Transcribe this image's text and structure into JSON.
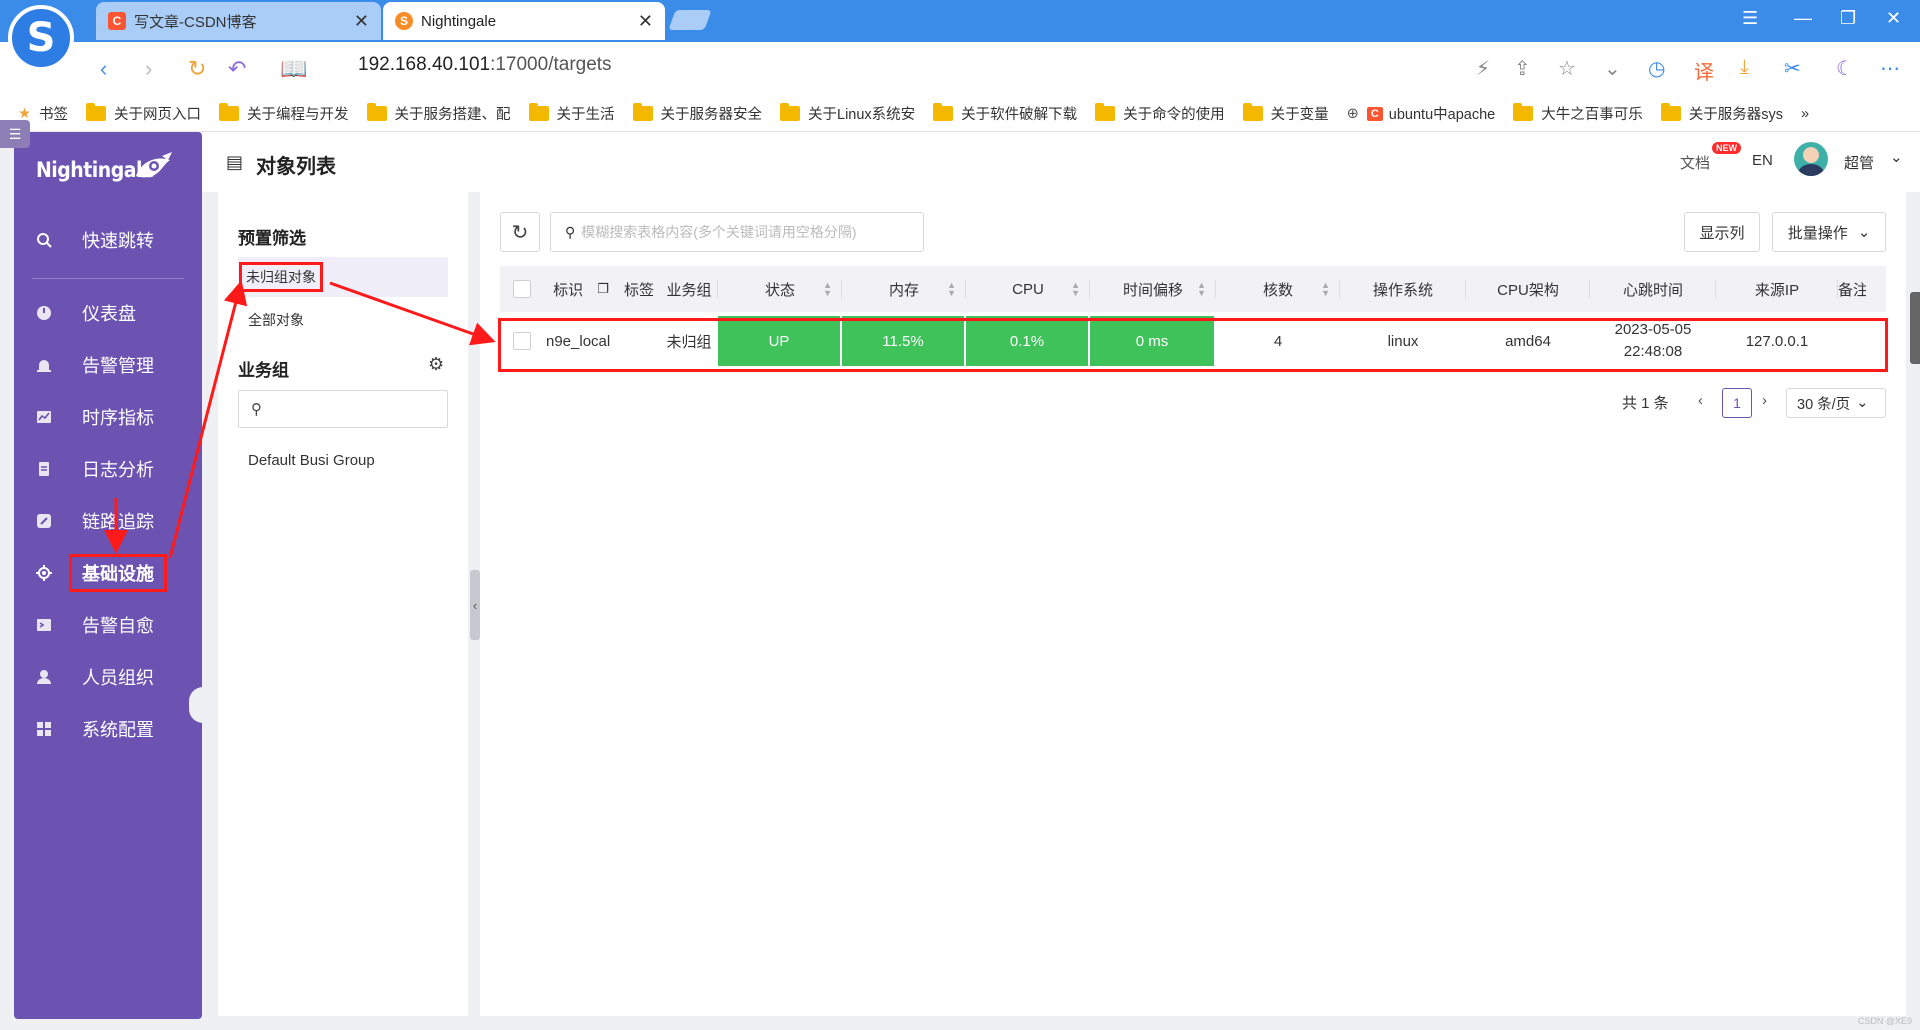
{
  "browser": {
    "logo_glyph": "S",
    "tabs": [
      {
        "title": "写文章-CSDN博客",
        "favicon": "C",
        "favicon_color": "#fc5531",
        "active": false
      },
      {
        "title": "Nightingale",
        "favicon": "S",
        "favicon_color": "#f78c26",
        "active": true
      }
    ],
    "close_glyph": "✕",
    "address": "192.168.40.101",
    "address_suffix": ":17000/targets",
    "bookmarks_label": "书签",
    "bookmarks": [
      "关于网页入口",
      "关于编程与开发",
      "关于服务搭建、配",
      "关于生活",
      "关于服务器安全",
      "关于Linux系统安",
      "关于软件破解下载",
      "关于命令的使用",
      "关于变量",
      "ubuntu中apache",
      "大牛之百事可乐",
      "关于服务器sys"
    ],
    "more_glyph": "»"
  },
  "app": {
    "brand": "Nightingale",
    "theme_color": "#6c53b1",
    "status_green": "#3fc25a",
    "highlight_red": "#ff1a1a",
    "menu": [
      {
        "label": "快速跳转",
        "icon": "search-icon"
      },
      {
        "label": "仪表盘",
        "icon": "dashboard-icon"
      },
      {
        "label": "告警管理",
        "icon": "alarm-icon"
      },
      {
        "label": "时序指标",
        "icon": "chart-icon"
      },
      {
        "label": "日志分析",
        "icon": "log-icon"
      },
      {
        "label": "链路追踪",
        "icon": "link-icon"
      },
      {
        "label": "基础设施",
        "icon": "target-icon",
        "active": true
      },
      {
        "label": "告警自愈",
        "icon": "terminal-icon"
      },
      {
        "label": "人员组织",
        "icon": "user-icon"
      },
      {
        "label": "系统配置",
        "icon": "grid-icon"
      }
    ]
  },
  "header": {
    "title": "对象列表",
    "docs": "文档",
    "new_badge": "NEW",
    "lang": "EN",
    "user": "超管"
  },
  "filter": {
    "preset_title": "预置筛选",
    "presets": [
      "未归组对象",
      "全部对象"
    ],
    "busi_title": "业务组",
    "busi_search_placeholder": "",
    "groups": [
      "Default Busi Group"
    ]
  },
  "main": {
    "search_placeholder": "模糊搜索表格内容(多个关键词请用空格分隔)",
    "show_columns": "显示列",
    "batch_ops": "批量操作",
    "columns": [
      "标识",
      "标签",
      "业务组",
      "状态",
      "内存",
      "CPU",
      "时间偏移",
      "核数",
      "操作系统",
      "CPU架构",
      "心跳时间",
      "来源IP",
      "备注"
    ],
    "rows": [
      {
        "ident": "n9e_local",
        "tags": "",
        "group": "未归组",
        "status": "UP",
        "mem": "11.5%",
        "cpu": "0.1%",
        "offset": "0 ms",
        "cores": "4",
        "os": "linux",
        "arch": "amd64",
        "heartbeat_date": "2023-05-05",
        "heartbeat_time": "22:48:08",
        "ip": "127.0.0.1",
        "note": ""
      }
    ],
    "pagination": {
      "total": "共 1 条",
      "current": "1",
      "page_size": "30 条/页"
    }
  },
  "watermark": "CSDN @XE9"
}
